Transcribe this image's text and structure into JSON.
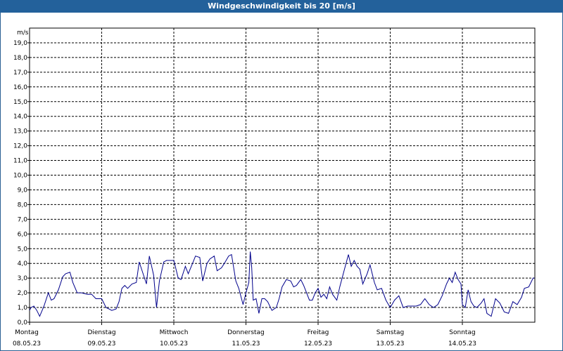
{
  "title": "Windgeschwindigkeit bis 20 [m/s]",
  "chart_data": {
    "type": "line",
    "title": "Windgeschwindigkeit bis 20 [m/s]",
    "ylabel": "m/s",
    "ylim": [
      0,
      20
    ],
    "grid": true,
    "yticks": [
      "0,0",
      "1,0",
      "2,0",
      "3,0",
      "4,0",
      "5,0",
      "6,0",
      "7,0",
      "8,0",
      "9,0",
      "10,0",
      "11,0",
      "12,0",
      "13,0",
      "14,0",
      "15,0",
      "16,0",
      "17,0",
      "18,0",
      "19,0"
    ],
    "xticks": [
      {
        "day": "Montag",
        "date": "08.05.23"
      },
      {
        "day": "Dienstag",
        "date": "09.05.23"
      },
      {
        "day": "Mittwoch",
        "date": "10.05.23"
      },
      {
        "day": "Donnerstag",
        "date": "11.05.23"
      },
      {
        "day": "Freitag",
        "date": "12.05.23"
      },
      {
        "day": "Samstag",
        "date": "13.05.23"
      },
      {
        "day": "Sonntag",
        "date": "14.05.23"
      }
    ],
    "series": [
      {
        "color": "#00008b",
        "x": [
          0.0,
          0.02,
          0.06,
          0.1,
          0.14,
          0.2,
          0.26,
          0.3,
          0.34,
          0.4,
          0.46,
          0.5,
          0.56,
          0.6,
          0.66,
          0.72,
          0.8,
          0.86,
          0.92,
          1.0,
          1.06,
          1.1,
          1.14,
          1.2,
          1.24,
          1.28,
          1.32,
          1.36,
          1.42,
          1.48,
          1.52,
          1.58,
          1.62,
          1.66,
          1.72,
          1.76,
          1.8,
          1.86,
          1.9,
          1.96,
          2.0,
          2.06,
          2.1,
          2.16,
          2.2,
          2.26,
          2.3,
          2.36,
          2.4,
          2.46,
          2.5,
          2.56,
          2.6,
          2.66,
          2.7,
          2.76,
          2.8,
          2.86,
          2.9,
          2.96,
          3.0,
          3.04,
          3.06,
          3.08,
          3.1,
          3.14,
          3.18,
          3.22,
          3.26,
          3.3,
          3.36,
          3.42,
          3.46,
          3.5,
          3.56,
          3.62,
          3.66,
          3.7,
          3.76,
          3.8,
          3.84,
          3.88,
          3.92,
          3.96,
          4.0,
          4.04,
          4.08,
          4.12,
          4.16,
          4.2,
          4.26,
          4.3,
          4.36,
          4.42,
          4.46,
          4.5,
          4.54,
          4.58,
          4.62,
          4.68,
          4.72,
          4.78,
          4.82,
          4.88,
          4.94,
          5.0,
          5.06,
          5.12,
          5.18,
          5.24,
          5.3,
          5.36,
          5.42,
          5.48,
          5.54,
          5.6,
          5.66,
          5.72,
          5.78,
          5.82,
          5.86,
          5.9,
          5.94,
          5.98,
          6.0,
          6.04,
          6.08,
          6.12,
          6.16,
          6.2,
          6.26,
          6.3,
          6.34,
          6.4,
          6.46,
          6.52,
          6.58,
          6.64,
          6.7,
          6.76,
          6.82,
          6.86,
          6.92,
          6.98,
          7.0
        ],
        "values": [
          0.8,
          1.0,
          1.1,
          0.8,
          0.4,
          1.1,
          2.0,
          1.5,
          1.6,
          2.2,
          3.1,
          3.3,
          3.4,
          2.7,
          2.0,
          2.0,
          1.9,
          1.9,
          1.6,
          1.6,
          1.0,
          0.9,
          0.8,
          0.9,
          1.4,
          2.3,
          2.5,
          2.3,
          2.6,
          2.7,
          4.1,
          3.2,
          2.6,
          4.5,
          3.2,
          1.0,
          2.8,
          4.1,
          4.2,
          4.2,
          4.2,
          3.0,
          2.9,
          3.8,
          3.3,
          4.0,
          4.5,
          4.4,
          2.8,
          4.0,
          4.3,
          4.5,
          3.5,
          3.7,
          4.0,
          4.5,
          4.6,
          2.8,
          2.3,
          1.2,
          2.0,
          2.7,
          4.8,
          3.7,
          1.5,
          1.6,
          0.6,
          1.6,
          1.6,
          1.4,
          0.8,
          1.0,
          1.6,
          2.4,
          2.9,
          2.8,
          2.4,
          2.5,
          2.9,
          2.5,
          2.0,
          1.5,
          1.5,
          2.0,
          2.3,
          1.7,
          1.9,
          1.6,
          2.4,
          1.9,
          1.5,
          2.4,
          3.5,
          4.6,
          3.8,
          4.2,
          3.8,
          3.6,
          2.6,
          3.3,
          3.9,
          2.7,
          2.2,
          2.3,
          1.5,
          1.0,
          1.5,
          1.8,
          1.0,
          1.1,
          1.1,
          1.1,
          1.2,
          1.6,
          1.2,
          1.0,
          1.2,
          1.8,
          2.6,
          3.0,
          2.7,
          3.4,
          2.9,
          2.6,
          1.2,
          1.0,
          2.2,
          1.4,
          1.1,
          1.0,
          1.3,
          1.6,
          0.6,
          0.4,
          1.6,
          1.3,
          0.7,
          0.6,
          1.4,
          1.2,
          1.7,
          2.3,
          2.4,
          3.0,
          3.0
        ]
      }
    ]
  }
}
